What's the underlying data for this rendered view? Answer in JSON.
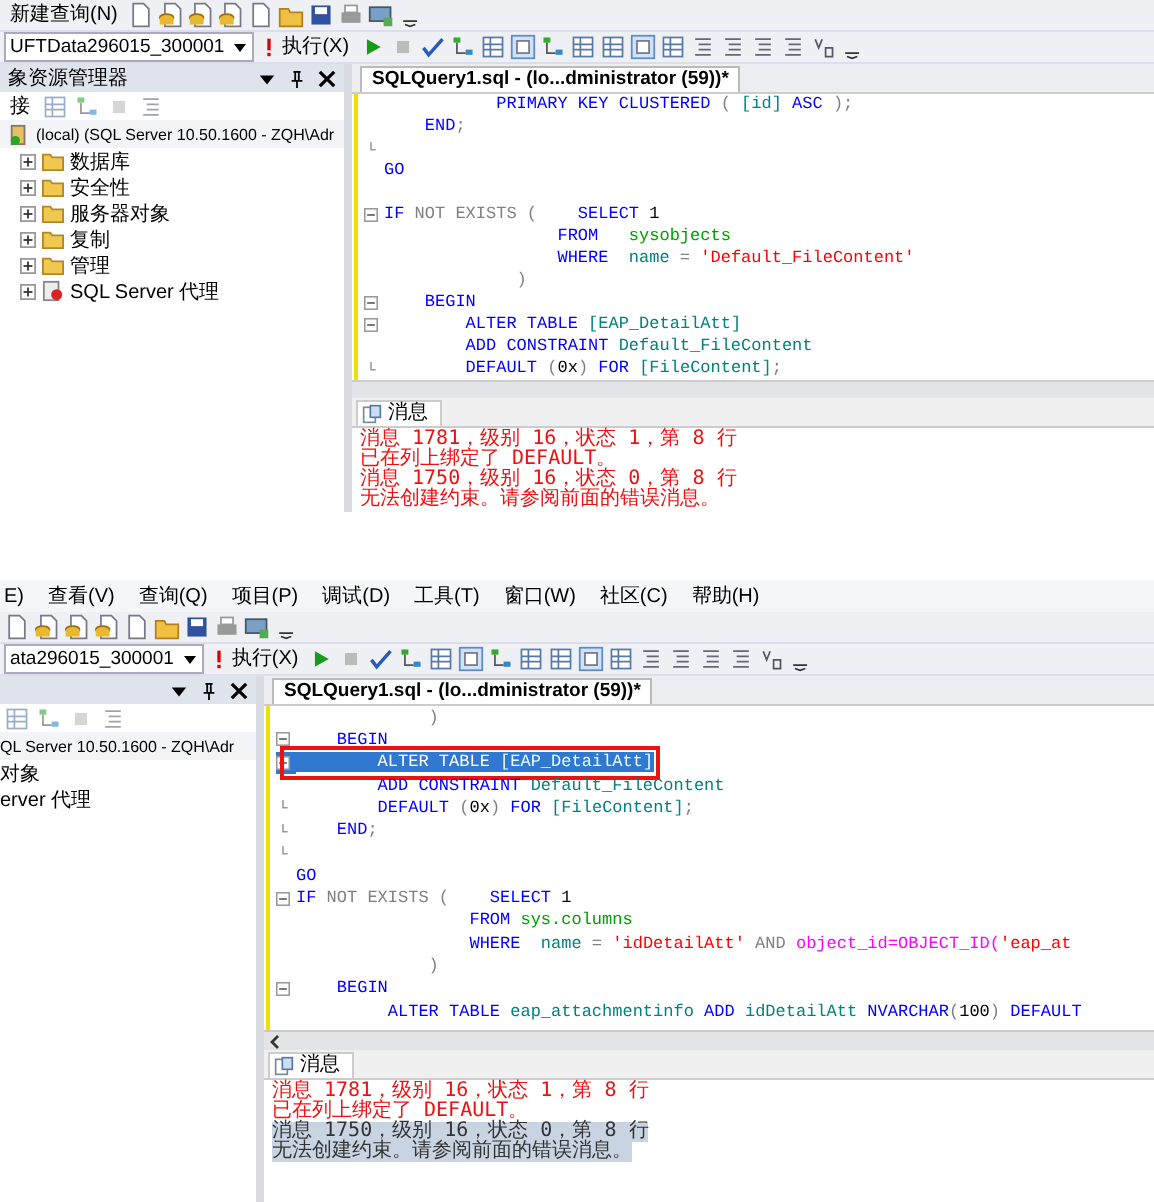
{
  "panels": [
    {
      "new_query": "新建查询(N)",
      "database": "UFTData296015_300001",
      "execute": "执行(X)",
      "explorer": {
        "title": "象资源管理器",
        "connect": "接",
        "server": "(local) (SQL Server 10.50.1600 - ZQH\\Adr",
        "nodes": [
          {
            "label": "数据库",
            "kind": "folder",
            "expanded": false
          },
          {
            "label": "安全性",
            "kind": "folder",
            "expanded": false
          },
          {
            "label": "服务器对象",
            "kind": "folder",
            "expanded": false
          },
          {
            "label": "复制",
            "kind": "folder",
            "expanded": false
          },
          {
            "label": "管理",
            "kind": "folder",
            "expanded": false
          },
          {
            "label": "SQL Server 代理",
            "kind": "agent",
            "expanded": false
          }
        ]
      },
      "editor_tab": "SQLQuery1.sql - (lo...dministrator (59))*",
      "code": [
        {
          "kind": "plain",
          "selected": false,
          "tokens": [
            {
              "kind": "kw",
              "text": "           PRIMARY KEY CLUSTERED"
            },
            {
              "kind": "op",
              "text": " ( "
            },
            {
              "kind": "obj",
              "text": "[id]"
            },
            {
              "kind": "kw",
              "text": " ASC"
            },
            {
              "kind": "op",
              "text": " );"
            }
          ]
        },
        {
          "kind": "plain",
          "selected": false,
          "tokens": [
            {
              "kind": "kw",
              "text": "    END"
            },
            {
              "kind": "op",
              "text": ";"
            }
          ]
        },
        {
          "kind": "close",
          "selected": false
        },
        {
          "kind": "plain",
          "selected": false,
          "tokens": [
            {
              "kind": "kw",
              "text": "GO"
            }
          ]
        },
        {
          "kind": "plain",
          "selected": false
        },
        {
          "kind": "open",
          "selected": false,
          "tokens": [
            {
              "kind": "kw",
              "text": "IF"
            },
            {
              "kind": "op",
              "text": " NOT EXISTS (    "
            },
            {
              "kind": "kw",
              "text": "SELECT"
            },
            {
              "kind": "txt",
              "text": " 1"
            }
          ]
        },
        {
          "kind": "plain",
          "selected": false,
          "tokens": [
            {
              "kind": "kw",
              "text": "                 FROM   "
            },
            {
              "kind": "sys",
              "text": "sysobjects"
            }
          ]
        },
        {
          "kind": "plain",
          "selected": false,
          "tokens": [
            {
              "kind": "kw",
              "text": "                 WHERE  "
            },
            {
              "kind": "obj",
              "text": "name"
            },
            {
              "kind": "op",
              "text": " = "
            },
            {
              "kind": "str",
              "text": "'Default_FileContent'"
            }
          ]
        },
        {
          "kind": "plain",
          "selected": false,
          "tokens": [
            {
              "kind": "op",
              "text": "             )"
            }
          ]
        },
        {
          "kind": "open",
          "selected": false,
          "tokens": [
            {
              "kind": "kw",
              "text": "    BEGIN"
            }
          ]
        },
        {
          "kind": "open",
          "selected": false,
          "tokens": [
            {
              "kind": "kw",
              "text": "        ALTER TABLE "
            },
            {
              "kind": "obj",
              "text": "[EAP_DetailAtt]"
            }
          ]
        },
        {
          "kind": "plain",
          "selected": false,
          "tokens": [
            {
              "kind": "kw",
              "text": "        ADD CONSTRAINT "
            },
            {
              "kind": "obj",
              "text": "Default_FileContent"
            }
          ]
        },
        {
          "kind": "close",
          "selected": false,
          "tokens": [
            {
              "kind": "kw",
              "text": "        DEFAULT "
            },
            {
              "kind": "op",
              "text": "("
            },
            {
              "kind": "txt",
              "text": "0x"
            },
            {
              "kind": "op",
              "text": ")"
            },
            {
              "kind": "kw",
              "text": " FOR "
            },
            {
              "kind": "obj",
              "text": "[FileContent]"
            },
            {
              "kind": "op",
              "text": ";"
            }
          ]
        }
      ],
      "messages_tab": "消息",
      "messages": [
        {
          "text": "消息 1781，级别 16，状态 1，第 8 行",
          "selected": false
        },
        {
          "text": "已在列上绑定了 DEFAULT。",
          "selected": false
        },
        {
          "text": "消息 1750，级别 16，状态 0，第 8 行",
          "selected": false
        },
        {
          "text": "无法创建约束。请参阅前面的错误消息。",
          "selected": false
        }
      ]
    },
    {
      "menu": [
        "E)",
        "查看(V)",
        "查询(Q)",
        "项目(P)",
        "调试(D)",
        "工具(T)",
        "窗口(W)",
        "社区(C)",
        "帮助(H)"
      ],
      "database": "ata296015_300001",
      "execute": "执行(X)",
      "explorer": {
        "server": "QL Server 10.50.1600 - ZQH\\Adr",
        "nodes": [
          {
            "label": "对象",
            "kind": "clipped"
          },
          {
            "label": "erver 代理",
            "kind": "clipped"
          }
        ]
      },
      "editor_tab": "SQLQuery1.sql - (lo...dministrator (59))*",
      "code": [
        {
          "kind": "plain",
          "selected": false,
          "tokens": [
            {
              "kind": "op",
              "text": "             )"
            }
          ]
        },
        {
          "kind": "open",
          "selected": false,
          "tokens": [
            {
              "kind": "kw",
              "text": "    BEGIN"
            }
          ]
        },
        {
          "kind": "open",
          "selected": true,
          "boxed": true,
          "tokens": [
            {
              "kind": "kw",
              "text": "        ALTER TABLE "
            },
            {
              "kind": "obj",
              "text": "[EAP_DetailAtt]"
            }
          ]
        },
        {
          "kind": "plain",
          "selected": false,
          "tokens": [
            {
              "kind": "kw",
              "text": "        ADD CONSTRAINT "
            },
            {
              "kind": "obj",
              "text": "Default_FileContent"
            }
          ]
        },
        {
          "kind": "close",
          "selected": false,
          "tokens": [
            {
              "kind": "kw",
              "text": "        DEFAULT "
            },
            {
              "kind": "op",
              "text": "("
            },
            {
              "kind": "txt",
              "text": "0x"
            },
            {
              "kind": "op",
              "text": ")"
            },
            {
              "kind": "kw",
              "text": " FOR "
            },
            {
              "kind": "obj",
              "text": "[FileContent]"
            },
            {
              "kind": "op",
              "text": ";"
            }
          ]
        },
        {
          "kind": "close",
          "selected": false,
          "tokens": [
            {
              "kind": "kw",
              "text": "    END"
            },
            {
              "kind": "op",
              "text": ";"
            }
          ]
        },
        {
          "kind": "close",
          "selected": false
        },
        {
          "kind": "plain",
          "selected": false,
          "tokens": [
            {
              "kind": "kw",
              "text": "GO"
            }
          ]
        },
        {
          "kind": "open",
          "selected": false,
          "tokens": [
            {
              "kind": "kw",
              "text": "IF"
            },
            {
              "kind": "op",
              "text": " NOT EXISTS (    "
            },
            {
              "kind": "kw",
              "text": "SELECT"
            },
            {
              "kind": "txt",
              "text": " 1"
            }
          ]
        },
        {
          "kind": "plain",
          "selected": false,
          "tokens": [
            {
              "kind": "kw",
              "text": "                 FROM "
            },
            {
              "kind": "sys",
              "text": "sys.columns"
            }
          ]
        },
        {
          "kind": "plain",
          "selected": false,
          "tokens": [
            {
              "kind": "kw",
              "text": "                 WHERE  "
            },
            {
              "kind": "obj",
              "text": "name"
            },
            {
              "kind": "op",
              "text": " = "
            },
            {
              "kind": "str",
              "text": "'idDetailAtt'"
            },
            {
              "kind": "op",
              "text": " AND "
            },
            {
              "kind": "fn",
              "text": "object_id=OBJECT_ID("
            },
            {
              "kind": "str",
              "text": "'eap_at"
            }
          ]
        },
        {
          "kind": "plain",
          "selected": false,
          "tokens": [
            {
              "kind": "op",
              "text": "             )"
            }
          ]
        },
        {
          "kind": "open",
          "selected": false,
          "tokens": [
            {
              "kind": "kw",
              "text": "    BEGIN"
            }
          ]
        },
        {
          "kind": "plain",
          "selected": false,
          "tokens": [
            {
              "kind": "kw",
              "text": "         ALTER TABLE "
            },
            {
              "kind": "obj",
              "text": "eap_attachmentinfo"
            },
            {
              "kind": "kw",
              "text": " ADD "
            },
            {
              "kind": "obj",
              "text": "idDetailAtt"
            },
            {
              "kind": "kw",
              "text": " NVARCHAR"
            },
            {
              "kind": "op",
              "text": "("
            },
            {
              "kind": "txt",
              "text": "100"
            },
            {
              "kind": "op",
              "text": ")"
            },
            {
              "kind": "kw",
              "text": " DEFAULT"
            }
          ]
        }
      ],
      "messages_tab": "消息",
      "messages": [
        {
          "text": "消息 1781，级别 16，状态 1，第 8 行",
          "selected": false
        },
        {
          "text": "已在列上绑定了 DEFAULT。",
          "selected": false
        },
        {
          "text": "消息 1750，级别 16，状态 0，第 8 行",
          "selected": true
        },
        {
          "text": "无法创建约束。请参阅前面的错误消息。",
          "selected": true
        }
      ]
    }
  ]
}
